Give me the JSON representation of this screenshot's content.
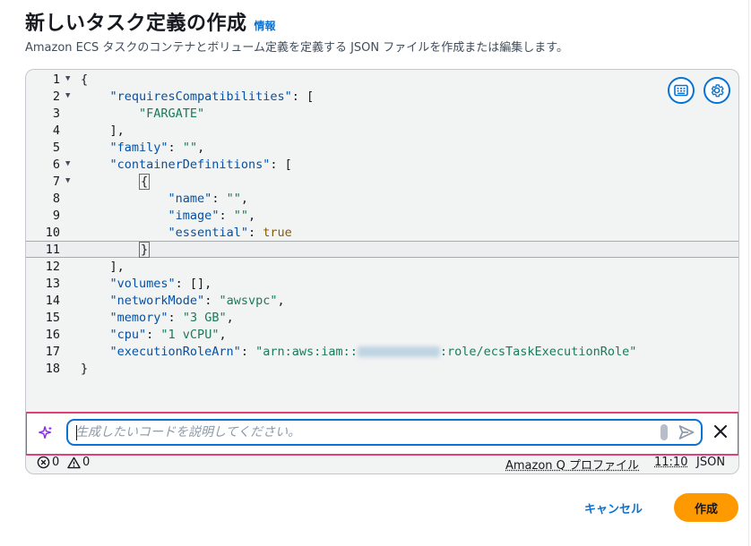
{
  "header": {
    "title": "新しいタスク定義の作成",
    "info_link": "情報",
    "description": "Amazon ECS タスクのコンテナとボリューム定義を定義する JSON ファイルを作成または編集します。"
  },
  "editor": {
    "line_numbers": [
      "1",
      "2",
      "3",
      "4",
      "5",
      "6",
      "7",
      "8",
      "9",
      "10",
      "11",
      "12",
      "13",
      "14",
      "15",
      "16",
      "17",
      "18"
    ],
    "code": {
      "l1": "{",
      "l2_key": "\"requiresCompatibilities\"",
      "l2_rest": ": [",
      "l3": "\"FARGATE\"",
      "l4": "],",
      "l5_key": "\"family\"",
      "l5_sep": ": ",
      "l5_val": "\"\"",
      "l5_end": ",",
      "l6_key": "\"containerDefinitions\"",
      "l6_rest": ": [",
      "l7": "{",
      "l8_key": "\"name\"",
      "l8_sep": ": ",
      "l8_val": "\"\"",
      "l8_end": ",",
      "l9_key": "\"image\"",
      "l9_sep": ": ",
      "l9_val": "\"\"",
      "l9_end": ",",
      "l10_key": "\"essential\"",
      "l10_sep": ": ",
      "l10_val": "true",
      "l11": "}",
      "l12": "],",
      "l13_key": "\"volumes\"",
      "l13_rest": ": [],",
      "l14_key": "\"networkMode\"",
      "l14_sep": ": ",
      "l14_val": "\"awsvpc\"",
      "l14_end": ",",
      "l15_key": "\"memory\"",
      "l15_sep": ": ",
      "l15_val": "\"3 GB\"",
      "l15_end": ",",
      "l16_key": "\"cpu\"",
      "l16_sep": ": ",
      "l16_val": "\"1 vCPU\"",
      "l16_end": ",",
      "l17_key": "\"executionRoleArn\"",
      "l17_sep": ": ",
      "l17_val_a": "\"arn:aws:iam::",
      "l17_val_b": ":role/ecsTaskExecutionRole\"",
      "l18": "}"
    },
    "icons": {
      "left": "keyboard-shortcuts-icon",
      "right": "settings-gear-icon"
    }
  },
  "amazon_q": {
    "placeholder": "生成したいコードを説明してください。",
    "icons": [
      "sparkle-icon",
      "send-icon",
      "close-icon"
    ]
  },
  "status_bar": {
    "errors": "0",
    "warnings": "0",
    "q_profile": "Amazon Q プロファイル",
    "cursor_position": "11:10",
    "language": "JSON"
  },
  "actions": {
    "cancel": "キャンセル",
    "create": "作成"
  },
  "colors": {
    "accent": "#0972d3",
    "primary_button": "#ff9900",
    "highlight_frame": "#e0407a"
  }
}
